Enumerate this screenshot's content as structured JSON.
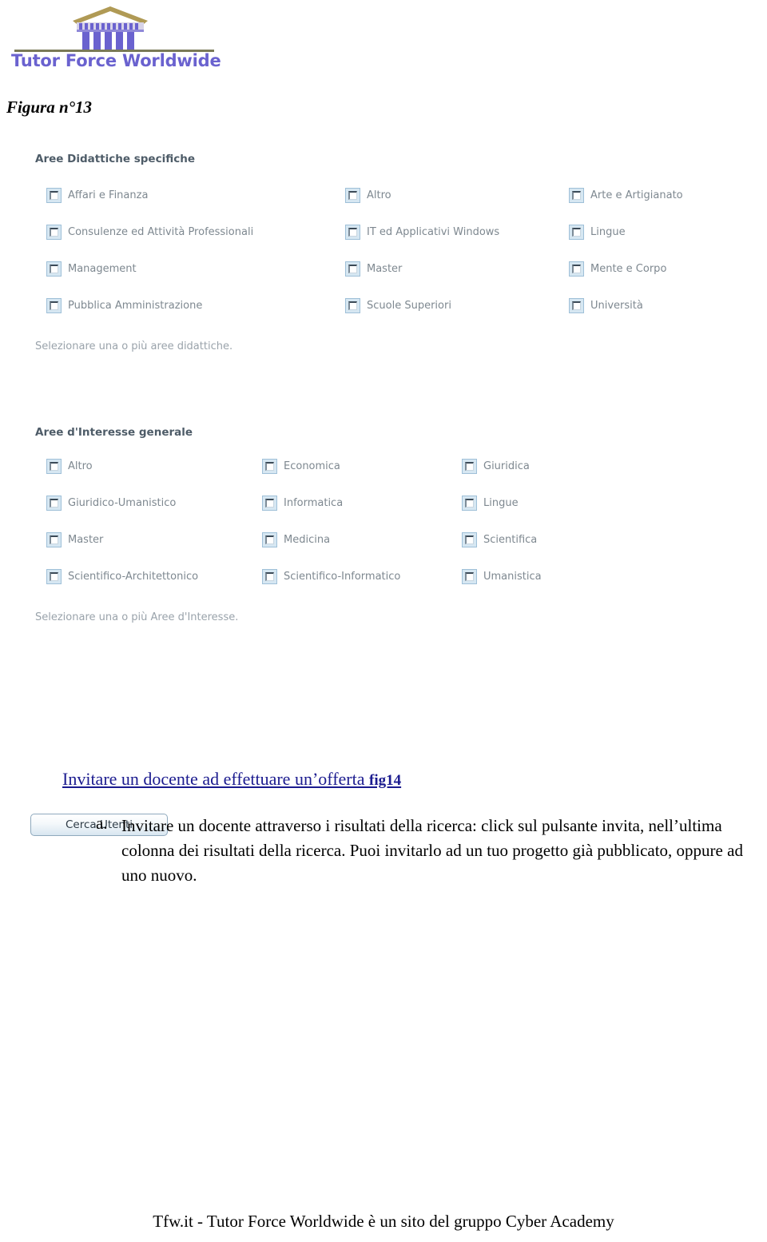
{
  "logo": {
    "wordmark": "Tutor Force Worldwide",
    "icon": "greek-temple-icon",
    "color": "#6a62cf",
    "rule_color": "#7a7a57",
    "pediment_color": "#b09a55"
  },
  "figure_caption": "Figura n°13",
  "form": {
    "section1": {
      "heading": "Aree Didattiche specifiche",
      "hint": "Selezionare una o più aree didattiche.",
      "columns": [
        [
          "Affari e Finanza",
          "Consulenze ed Attività Professionali",
          "Management",
          "Pubblica Amministrazione"
        ],
        [
          "Altro",
          "IT ed Applicativi Windows",
          "Master",
          "Scuole Superiori"
        ],
        [
          "Arte e Artigianato",
          "Lingue",
          "Mente e Corpo",
          "Università"
        ]
      ]
    },
    "section2": {
      "heading": "Aree d'Interesse generale",
      "hint": "Selezionare una o più Aree d'Interesse.",
      "columns": [
        [
          "Altro",
          "Giuridico-Umanistico",
          "Master",
          "Scientifico-Architettonico"
        ],
        [
          "Economica",
          "Informatica",
          "Medicina",
          "Scientifico-Informatico"
        ],
        [
          "Giuridica",
          "Lingue",
          "Scientifica",
          "Umanistica"
        ]
      ]
    },
    "search_button_label": "Cerca Utenti",
    "checkbox_fill": "#d6e7f2",
    "heading_color": "#4e5c68",
    "label_color": "#7e8890",
    "hint_color": "#9aa3ab"
  },
  "document": {
    "section_link_text": "Invitare un docente ad effettuare un’offerta ",
    "section_link_fig": "fig14",
    "list_marker": "a.",
    "list_paragraph": "Invitare un docente attraverso i risultati della ricerca: click sul pulsante invita, nell’ultima colonna dei risultati della ricerca. Puoi invitarlo ad un tuo progetto già pubblicato, oppure ad uno nuovo.",
    "link_color": "#1b1b8f"
  },
  "footer": {
    "text": "Tfw.it - Tutor Force Worldwide è un sito del gruppo Cyber Academy"
  }
}
